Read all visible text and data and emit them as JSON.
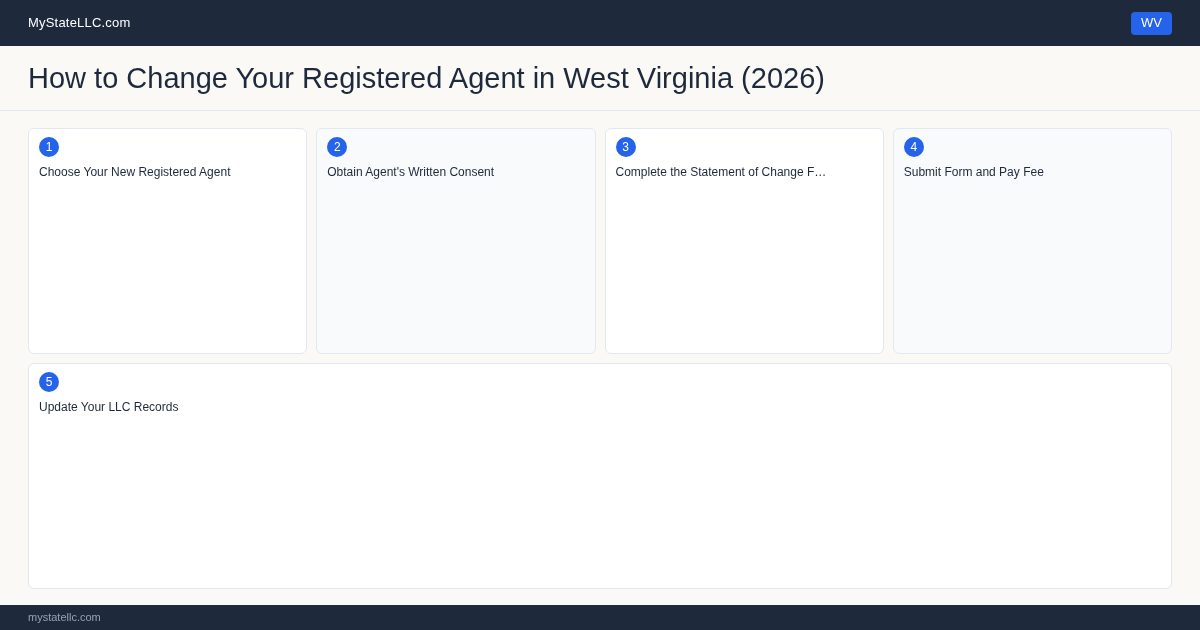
{
  "header": {
    "site_name": "MyStateLLC.com",
    "state_badge": "WV"
  },
  "page_title": "How to Change Your Registered Agent in West Virginia (2026)",
  "steps": [
    {
      "number": "1",
      "title": "Choose Your New Registered Agent"
    },
    {
      "number": "2",
      "title": "Obtain Agent's Written Consent"
    },
    {
      "number": "3",
      "title": "Complete the Statement of Change F…"
    },
    {
      "number": "4",
      "title": "Submit Form and Pay Fee"
    },
    {
      "number": "5",
      "title": "Update Your LLC Records"
    }
  ],
  "footer": {
    "text": "mystatellc.com"
  }
}
